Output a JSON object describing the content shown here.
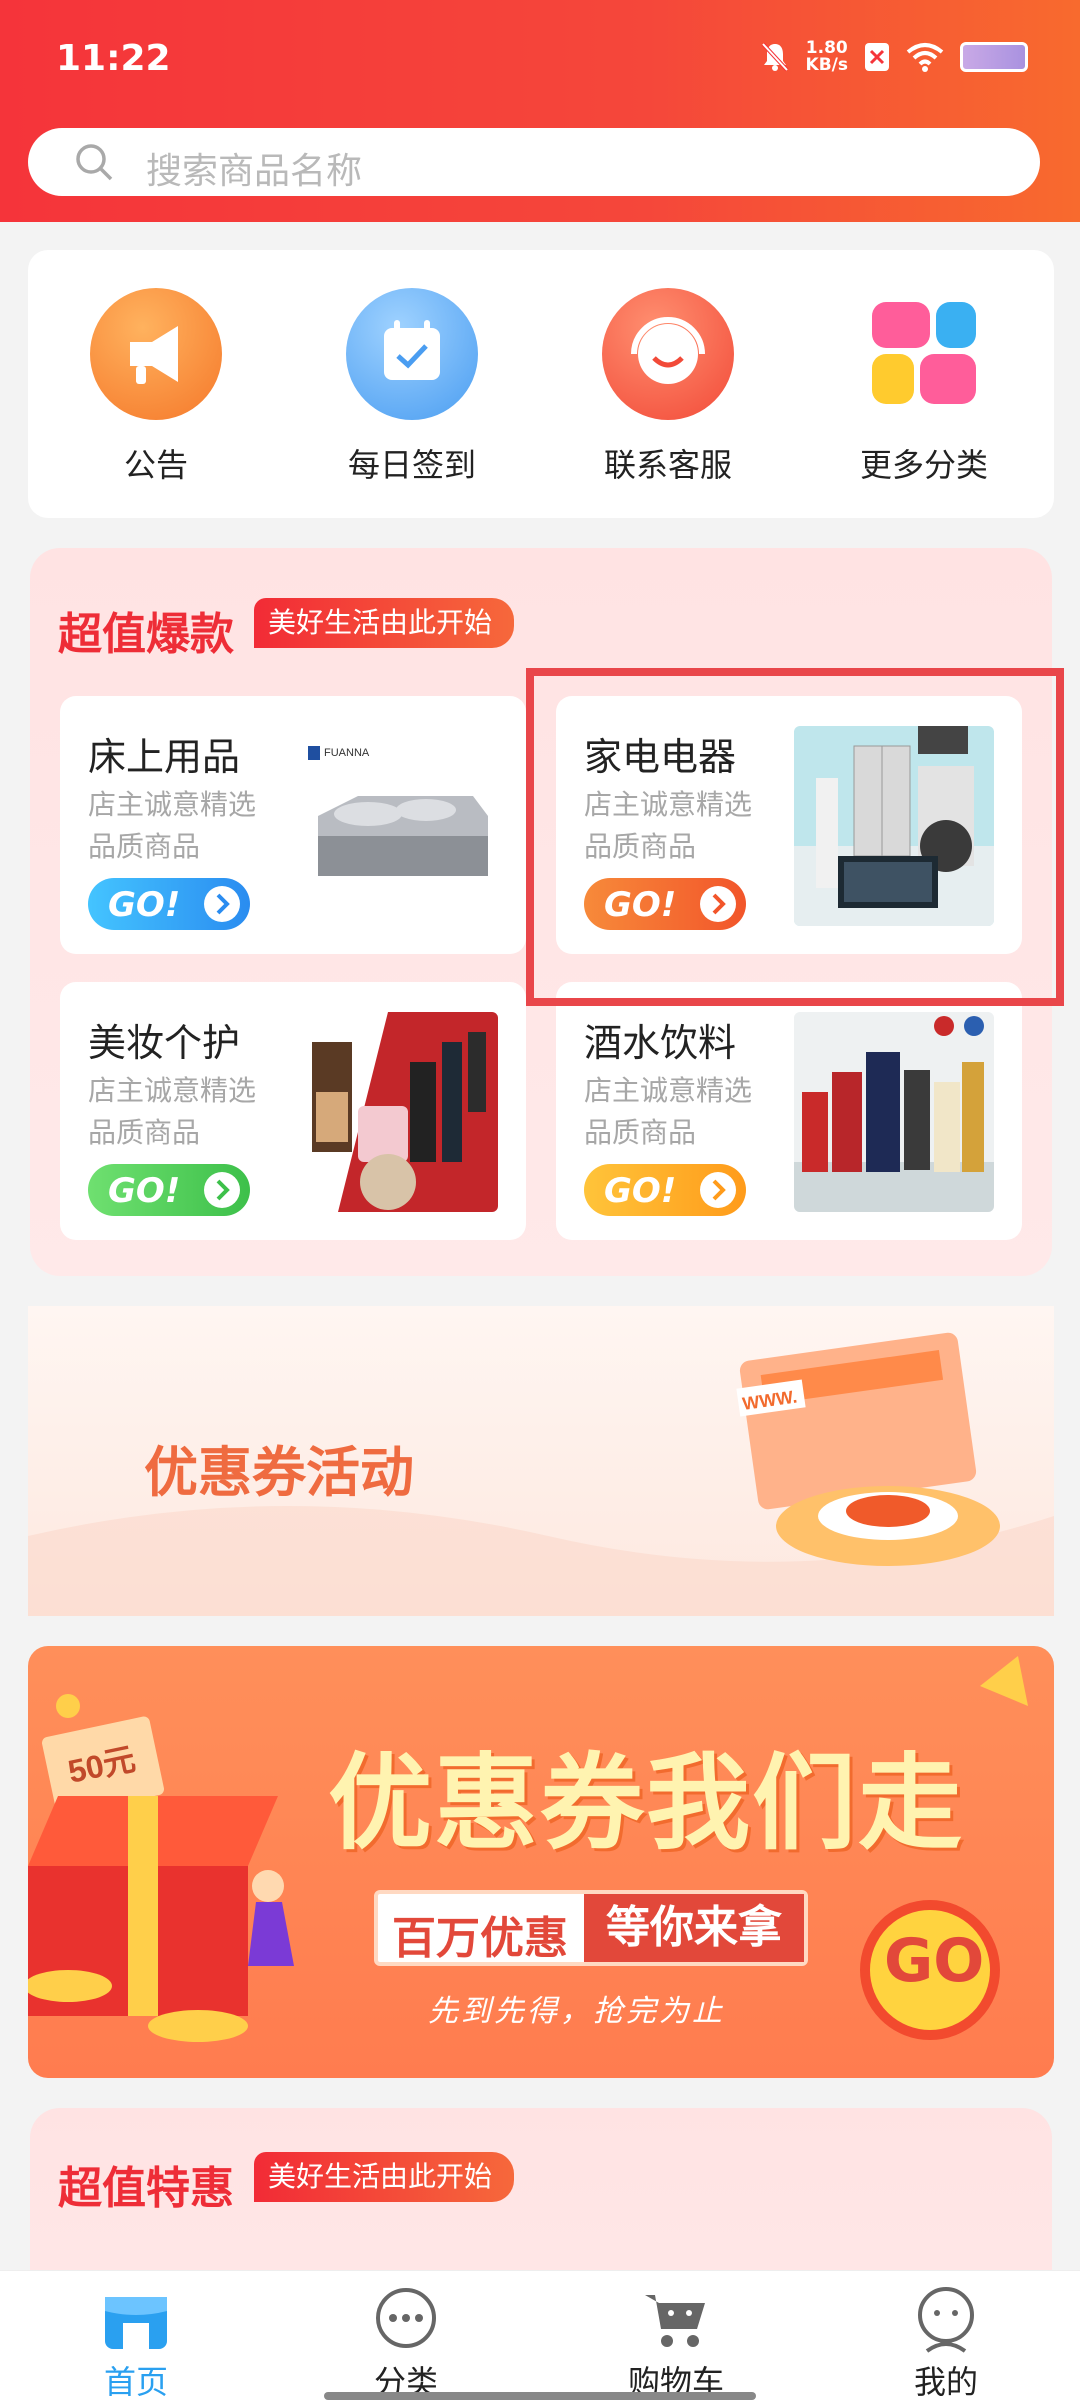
{
  "status_bar": {
    "time": "11:22",
    "net_speed": "1.80",
    "net_unit": "KB/s"
  },
  "search": {
    "placeholder": "搜索商品名称"
  },
  "quick_menu": [
    {
      "label": "公告",
      "icon": "megaphone-icon"
    },
    {
      "label": "每日签到",
      "icon": "calendar-check-icon"
    },
    {
      "label": "联系客服",
      "icon": "headset-icon"
    },
    {
      "label": "更多分类",
      "icon": "category-grid-icon"
    }
  ],
  "hot_section": {
    "title": "超值爆款",
    "tag": "美好生活由此开始",
    "cards": [
      {
        "title": "床上用品",
        "subtitle": "店主诚意精选品质商品",
        "go_label": "GO!",
        "image": "bedding-photo",
        "brand": "FUANNA",
        "go_color": "#3ab0f2"
      },
      {
        "title": "家电电器",
        "subtitle": "店主诚意精选品质商品",
        "go_label": "GO!",
        "image": "appliances-photo",
        "go_color": "#f56a2e"
      },
      {
        "title": "美妆个护",
        "subtitle": "店主诚意精选品质商品",
        "go_label": "GO!",
        "image": "cosmetics-photo",
        "go_color": "#52d15a"
      },
      {
        "title": "酒水饮料",
        "subtitle": "店主诚意精选品质商品",
        "go_label": "GO!",
        "image": "liquor-photo",
        "go_color": "#ffae24"
      }
    ]
  },
  "coupon_banner": {
    "title": "优惠券活动",
    "badge": "WWW."
  },
  "promo_banner": {
    "title": "优惠券我们走",
    "box_left": "百万优惠",
    "box_right": "等你来拿",
    "subtitle": "先到先得，抢完为止",
    "go_label": "GO",
    "price_tag": "50元"
  },
  "special_section": {
    "title": "超值特惠",
    "tag": "美好生活由此开始"
  },
  "tab_bar": [
    {
      "label": "首页",
      "icon": "store-icon",
      "active": true
    },
    {
      "label": "分类",
      "icon": "more-dots-icon",
      "active": false
    },
    {
      "label": "购物车",
      "icon": "cart-icon",
      "active": false
    },
    {
      "label": "我的",
      "icon": "user-icon",
      "active": false
    }
  ],
  "colors": {
    "primary": "#f5343a",
    "accent": "#ee2d37",
    "tab_active": "#2aa0f0"
  }
}
